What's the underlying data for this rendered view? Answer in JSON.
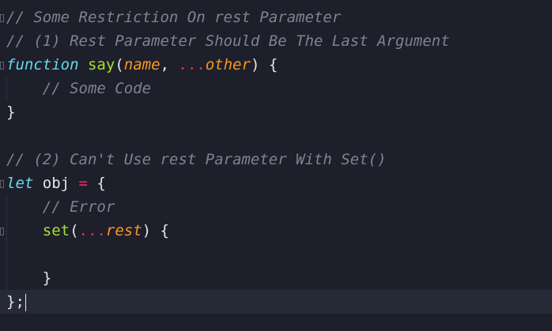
{
  "colors": {
    "background": "#1d1f2a",
    "current_line": "#262a36",
    "comment": "#7d8491",
    "keyword": "#66d9ef",
    "function": "#a6e22e",
    "parameter": "#fd971f",
    "operator": "#f92672",
    "text": "#e6e6e6"
  },
  "code": {
    "l1": {
      "comment": "// Some Restriction On rest Parameter"
    },
    "l2": {
      "comment": "// (1) Rest Parameter Should Be The Last Argument"
    },
    "l3": {
      "kw": "function",
      "sp1": " ",
      "fn": "say",
      "open": "(",
      "p1": "name",
      "comma": ", ",
      "spread": "...",
      "p2": "other",
      "close": ") {"
    },
    "l4": {
      "indent": "    ",
      "comment": "// Some Code"
    },
    "l5": {
      "text": "}"
    },
    "l6": {
      "text": ""
    },
    "l7": {
      "comment": "// (2) Can't Use rest Parameter With Set()"
    },
    "l8": {
      "kw": "let",
      "name": " obj ",
      "eq": "=",
      "rest": " {"
    },
    "l9": {
      "indent": "    ",
      "comment": "// Error"
    },
    "l10": {
      "indent": "    ",
      "fn": "set",
      "open": "(",
      "spread": "...",
      "p": "rest",
      "close": ") {"
    },
    "l11": {
      "text": ""
    },
    "l12": {
      "indent": "    ",
      "text": "}"
    },
    "l13": {
      "text": "};"
    }
  }
}
